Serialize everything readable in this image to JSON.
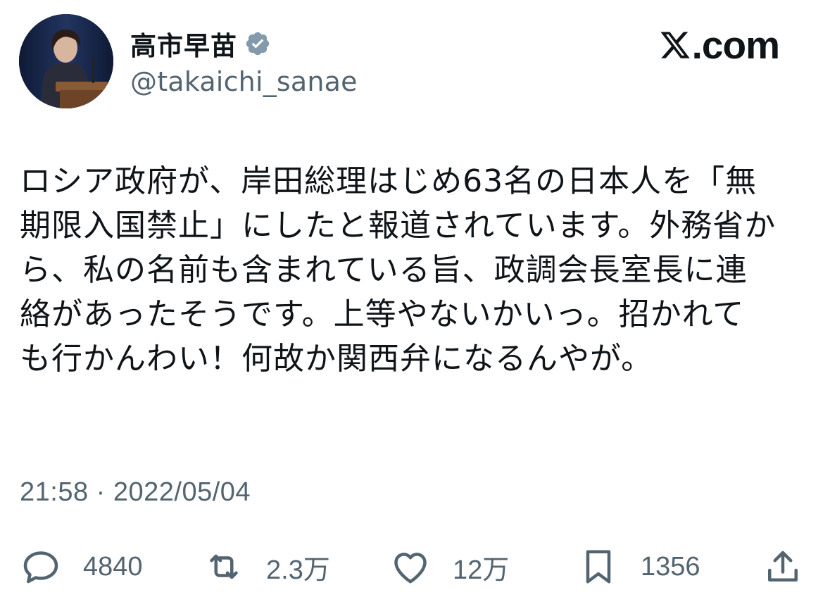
{
  "user": {
    "display_name": "高市早苗",
    "handle": "@takaichi_sanae",
    "verified": true,
    "avatar": "profile-photo"
  },
  "brand": {
    "logo": "x-logo-icon",
    "text": ".com"
  },
  "tweet": {
    "lines": [
      "ロシア政府が、岸田総理はじめ63名の日本人を「無",
      "期限入国禁止」にしたと報道されています。外務省か",
      "ら、私の名前も含まれている旨、政調会長室長に連",
      "絡があったそうです。上等やないかいっ。招かれて",
      "も行かんわい！何故か関西弁になるんやが。"
    ],
    "timestamp": "21:58 · 2022/05/04"
  },
  "actions": {
    "reply": {
      "icon": "reply-icon",
      "count": "4840"
    },
    "retweet": {
      "icon": "retweet-icon",
      "count": "2.3万"
    },
    "like": {
      "icon": "heart-icon",
      "count": "12万"
    },
    "bookmark": {
      "icon": "bookmark-icon",
      "count": "1356"
    },
    "share": {
      "icon": "share-icon"
    }
  },
  "colors": {
    "text": "#0f1419",
    "secondary": "#536471",
    "verified_badge": "#829aab",
    "background": "#ffffff"
  }
}
